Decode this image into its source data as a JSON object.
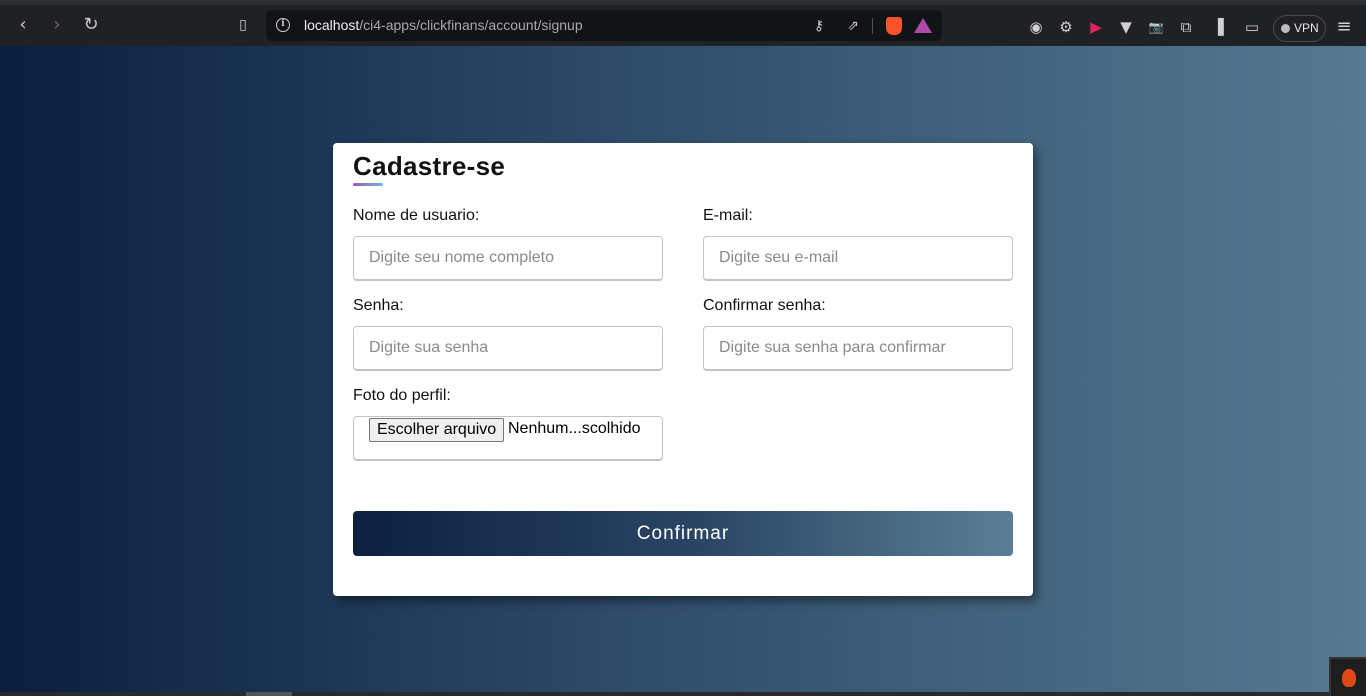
{
  "browser": {
    "url_host": "localhost",
    "url_path": "/ci4-apps/clickfinans/account/signup",
    "vpn_label": "VPN",
    "icons": {
      "back": "chevron-left-icon",
      "forward": "chevron-right-icon",
      "reload": "reload-icon",
      "bookmark": "bookmark-icon",
      "info": "info-icon",
      "key": "key-icon",
      "share": "share-icon",
      "brave": "brave-shields-icon",
      "rewards": "brave-rewards-icon",
      "menu": "menu-icon"
    },
    "glyphs": {
      "back": "‹",
      "forward": "›",
      "reload": "↻",
      "bookmark": "🔖",
      "info": "i",
      "key": "⚷",
      "share": "⇗",
      "ext1": "◉",
      "ext2": "⚙",
      "ext3": "▶",
      "ext4": "▼",
      "ext5": "📷",
      "ext6": "⧉",
      "ext7": "▐",
      "ext8": "▭",
      "menu": "≡"
    }
  },
  "form": {
    "title": "Cadastre-se",
    "username_label": "Nome de usuario:",
    "username_placeholder": "Digite seu nome completo",
    "email_label": "E-mail:",
    "email_placeholder": "Digite seu e-mail",
    "password_label": "Senha:",
    "password_placeholder": "Digite sua senha",
    "confirm_label": "Confirmar senha:",
    "confirm_placeholder": "Digite sua senha para confirmar",
    "photo_label": "Foto do perfil:",
    "file_button": "Escolher arquivo",
    "file_status": "Nenhum...scolhido",
    "submit_label": "Confirmar"
  },
  "colors": {
    "accent_dark": "#0c1f3f",
    "accent_light": "#5a7f96",
    "underline_start": "#9b59b6",
    "underline_end": "#71b7e6"
  }
}
